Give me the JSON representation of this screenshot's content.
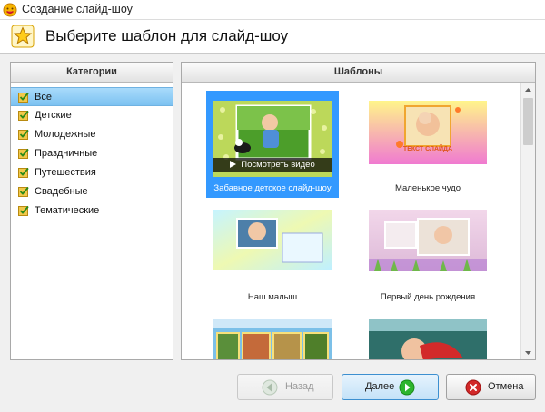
{
  "window": {
    "title": "Создание слайд-шоу"
  },
  "header": {
    "title": "Выберите шаблон для слайд-шоу"
  },
  "categories": {
    "heading": "Категории",
    "items": [
      {
        "label": "Все",
        "selected": true
      },
      {
        "label": "Детские"
      },
      {
        "label": "Молодежные"
      },
      {
        "label": "Праздничные"
      },
      {
        "label": "Путешествия"
      },
      {
        "label": "Свадебные"
      },
      {
        "label": "Тематические"
      }
    ]
  },
  "templates": {
    "heading": "Шаблоны",
    "play_label": "Посмотреть видео",
    "preview_caption": "ТЕКСТ СЛАЙДА",
    "items": [
      {
        "label": "Забавное детское слайд-шоу",
        "selected": true
      },
      {
        "label": "Маленькое чудо"
      },
      {
        "label": "Наш малыш"
      },
      {
        "label": "Первый день рождения"
      },
      {
        "label": ""
      },
      {
        "label": ""
      }
    ]
  },
  "buttons": {
    "back": "Назад",
    "next": "Далее",
    "cancel": "Отмена"
  },
  "colors": {
    "selection": "#3399ff",
    "category_selected": "#8ecbf5",
    "accept_green": "#2db52d",
    "cancel_red": "#d22828"
  },
  "icons": {
    "app": "smiley-icon",
    "header": "star-icon",
    "category": "checked-note-icon"
  }
}
